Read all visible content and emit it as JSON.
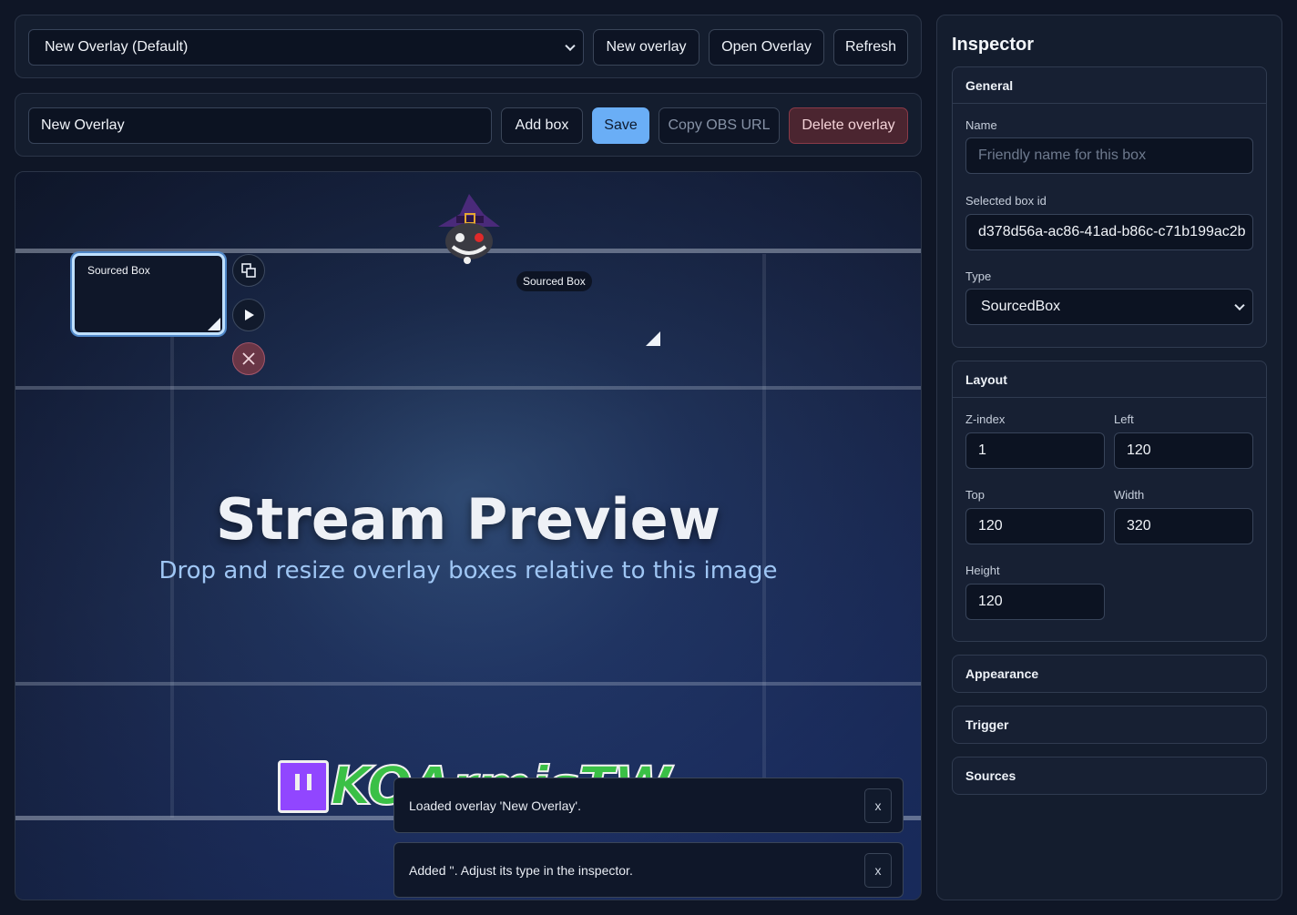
{
  "topbar": {
    "overlay_select": "New Overlay (Default)",
    "new_overlay": "New overlay",
    "open_overlay": "Open Overlay",
    "refresh": "Refresh"
  },
  "editbar": {
    "name_value": "New Overlay",
    "add_box": "Add box",
    "save": "Save",
    "copy_obs_url": "Copy OBS URL",
    "delete_overlay": "Delete overlay"
  },
  "preview": {
    "title": "Stream Preview",
    "subtitle": "Drop and resize overlay boxes relative to this image",
    "selected_box_label": "Sourced Box",
    "other_box_label": "Sourced Box",
    "brand_text": "KOArmisTW"
  },
  "toasts": [
    {
      "text": "Loaded overlay 'New Overlay'.",
      "close": "x"
    },
    {
      "text": "Added ''. Adjust its type in the inspector.",
      "close": "x"
    }
  ],
  "inspector": {
    "title": "Inspector",
    "general": {
      "heading": "General",
      "name_label": "Name",
      "name_placeholder": "Friendly name for this box",
      "id_label": "Selected box id",
      "id_value": "d378d56a-ac86-41ad-b86c-c71b199ac2b",
      "type_label": "Type",
      "type_value": "SourcedBox"
    },
    "layout": {
      "heading": "Layout",
      "zindex_label": "Z-index",
      "zindex_value": "1",
      "left_label": "Left",
      "left_value": "120",
      "top_label": "Top",
      "top_value": "120",
      "width_label": "Width",
      "width_value": "320",
      "height_label": "Height",
      "height_value": "120"
    },
    "appearance": "Appearance",
    "trigger": "Trigger",
    "sources": "Sources"
  },
  "colors": {
    "accent": "#6aaef6",
    "danger_bg": "#4b2530",
    "panel": "#141d2e",
    "background": "#0f1626"
  },
  "icons": [
    "duplicate-icon",
    "play-icon",
    "close-icon",
    "chevron-down-icon",
    "mascot-avatar",
    "twitch-logo"
  ]
}
